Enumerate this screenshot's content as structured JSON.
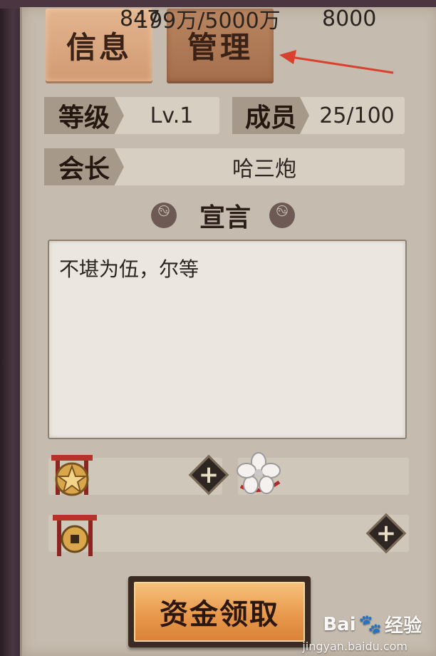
{
  "tabs": {
    "info": "信息",
    "manage": "管理"
  },
  "stats": {
    "level_label": "等级",
    "level_value": "Lv.1",
    "members_label": "成员",
    "members_value": "25/100",
    "leader_label": "会长",
    "leader_value": "哈三炮"
  },
  "declaration": {
    "title": "宣言",
    "text": "不堪为伍，尔等"
  },
  "resources": {
    "emblem_value": "847",
    "blossom_value": "8000",
    "funds_value": "199万/5000万"
  },
  "claim_button": "资金领取",
  "watermark": {
    "brand": "Bai",
    "brand_suffix": "经验",
    "site": "jingyan.baidu.com"
  },
  "colors": {
    "panel": "#c5bbae",
    "tab_active": "#d19a73",
    "tab_inactive": "#a56f4d",
    "arrow": "#d9412e",
    "claim_button": "#e7964a"
  },
  "icons": {
    "emblem": "pentagram-torii-icon",
    "blossom": "sakura-icon",
    "coin": "coin-torii-icon",
    "tomoe": "tomoe-icon",
    "plus": "plus-icon"
  }
}
